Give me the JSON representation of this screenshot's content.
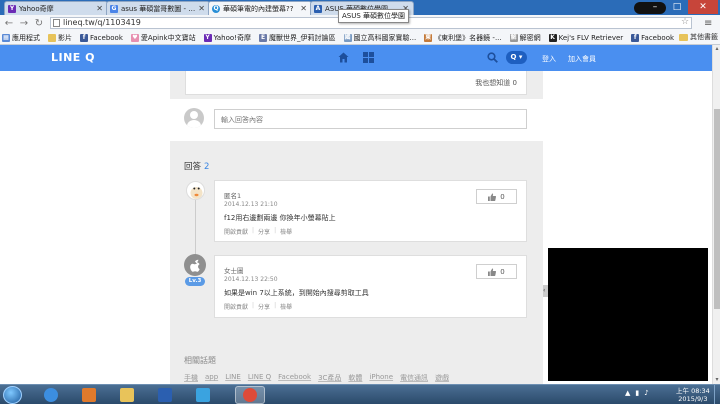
{
  "browser": {
    "tabs": [
      {
        "title": "Yahoo奇摩",
        "favicon": "Y",
        "favicon_color": "#6b2bb5",
        "active": false
      },
      {
        "title": "asus 華碩當哥數圖 - Goo",
        "favicon": "G",
        "favicon_color": "#4a84e8",
        "active": false
      },
      {
        "title": "華碩筆電的內建螢幕??",
        "favicon": "Q",
        "favicon_color": "#2a8fd6",
        "active": true
      },
      {
        "title": "ASUS 華碩數位學園",
        "favicon": "A",
        "favicon_color": "#2b5fb0",
        "active": false
      }
    ],
    "tooltip": "ASUS 華碩數位學園",
    "url": "lineq.tw/q/1103419",
    "window_controls": {
      "minimize": "–",
      "maximize": "□",
      "close": "✕"
    },
    "bookmarks": [
      {
        "label": "應用程式",
        "icon_color": "#5a8ad6",
        "icon": "▦"
      },
      {
        "label": "影片",
        "icon_color": "#e7c35a",
        "icon": ""
      },
      {
        "label": "Facebook",
        "icon_color": "#3b5998",
        "icon": "f"
      },
      {
        "label": "愛Apink中文寶站",
        "icon_color": "#e78fb0",
        "icon": "♥"
      },
      {
        "label": "Yahoo!奇摩",
        "icon_color": "#6b2bb5",
        "icon": "Y"
      },
      {
        "label": "魔獸世界_伊莉討論區",
        "icon_color": "#6b7aa8",
        "icon": "E"
      },
      {
        "label": "國立高科國家實驗...",
        "icon_color": "#7a9bc2",
        "icon": "國"
      },
      {
        "label": "《東利堡》名器鏡 -...",
        "icon_color": "#c47a3a",
        "icon": "東"
      },
      {
        "label": "解密網",
        "icon_color": "#999999",
        "icon": "解"
      },
      {
        "label": "Kej's FLV Retriever",
        "icon_color": "#222222",
        "icon": "K"
      },
      {
        "label": "Facebook",
        "icon_color": "#3b5998",
        "icon": "f"
      }
    ],
    "other_bookmarks": "其他書籤"
  },
  "site": {
    "logo": "LINE Q",
    "header_color": "#4a8ff0",
    "q_button": "Q",
    "login": "登入",
    "join": "加入會員"
  },
  "question": {
    "metoo_label": "我也想知道",
    "metoo_count": "0",
    "comment_placeholder": "輸入回答內容"
  },
  "answers_section": {
    "title": "回答",
    "count": "2",
    "items": [
      {
        "name": "匿名1",
        "date": "2014.12.13 21:10",
        "text": "f12用右邊劃兩邊 你換年小螢幕貼上",
        "likes": "0",
        "actions": [
          "開啟貢獻",
          "分享",
          "檢舉"
        ]
      },
      {
        "name": "女士圖",
        "date": "2014.12.13 22:50",
        "text": "如果是win 7以上系統，到開始內搜尋剪取工具",
        "likes": "0",
        "actions": [
          "開啟貢獻",
          "分享",
          "檢舉"
        ],
        "level": "Lv.3"
      }
    ]
  },
  "related": {
    "title": "相關話題",
    "tags": [
      "手機",
      "app",
      "LINE",
      "LINE Q",
      "Facebook",
      "3C產品",
      "軟體",
      "iPhone",
      "電信通訊",
      "遊戲"
    ]
  },
  "taskbar": {
    "apps": [
      {
        "name": "ie",
        "color": "#3c8ee0"
      },
      {
        "name": "media",
        "color": "#e07a2c"
      },
      {
        "name": "folder",
        "color": "#e8c35a"
      },
      {
        "name": "word",
        "color": "#2b5fb0"
      },
      {
        "name": "app",
        "color": "#3aa3e0"
      },
      {
        "name": "chrome",
        "color": "#dd4b39"
      }
    ],
    "time": "上午 08:34",
    "date": "2015/9/3"
  }
}
